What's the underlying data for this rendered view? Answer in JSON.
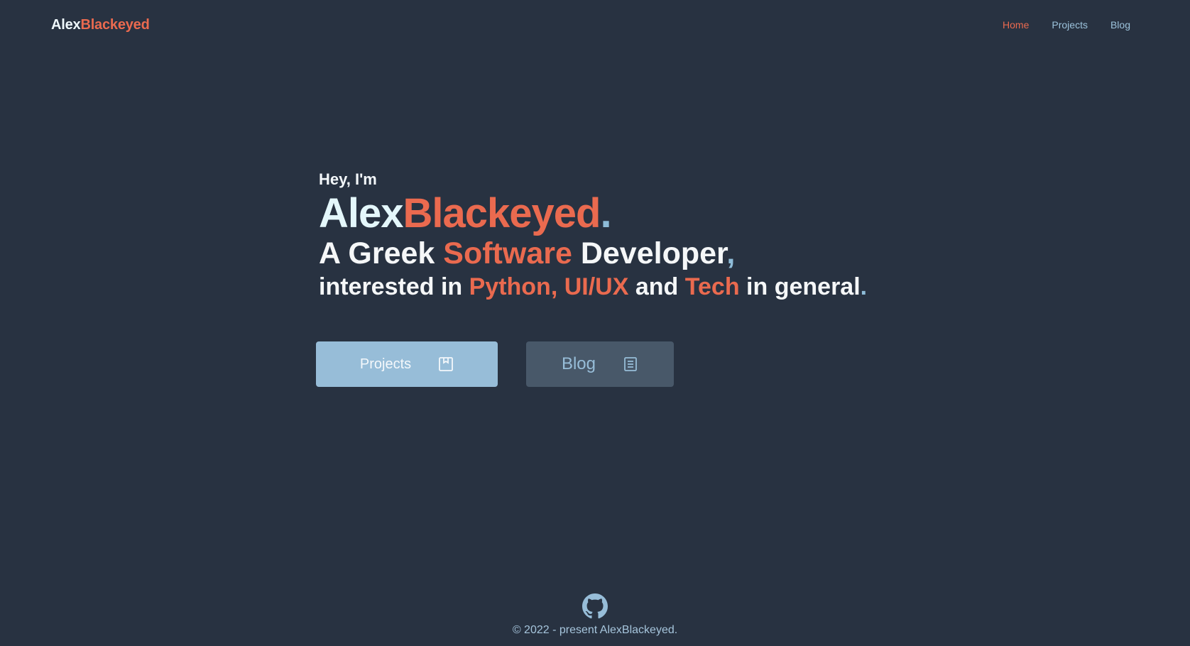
{
  "header": {
    "logo_first": "Alex",
    "logo_last": "Blackeyed",
    "nav": [
      {
        "label": "Home",
        "active": true
      },
      {
        "label": "Projects",
        "active": false
      },
      {
        "label": "Blog",
        "active": false
      }
    ]
  },
  "hero": {
    "greeting": "Hey, I'm",
    "name_first": "Alex",
    "name_last": "Blackeyed",
    "name_dot": ".",
    "line1": {
      "a": "A Greek ",
      "highlight": "Software",
      "b": " Developer",
      "punct": ","
    },
    "line2": {
      "a": "interested in ",
      "python": "Python",
      "comma": ",",
      "space": " ",
      "uiux": "UI/UX",
      "and": " and ",
      "tech": "Tech",
      "b": " in general",
      "punct": "."
    }
  },
  "buttons": {
    "projects_label": "Projects",
    "projects_icon": "bookmark-box-icon",
    "blog_label": "Blog",
    "blog_icon": "document-icon"
  },
  "footer": {
    "icon": "github-icon",
    "copyright": "© 2022 - present AlexBlackeyed."
  },
  "colors": {
    "background": "#283241",
    "accent": "#ea6a4f",
    "secondary": "#97bdd8",
    "text": "#f5f7f8"
  }
}
